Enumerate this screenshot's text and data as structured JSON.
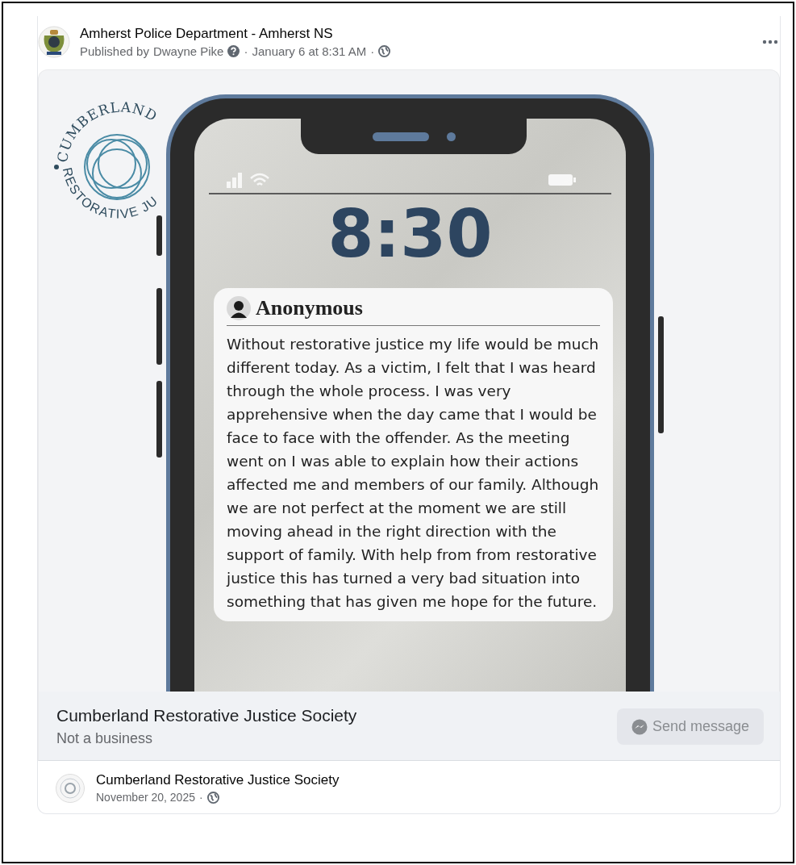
{
  "post": {
    "author": "Amherst Police Department - Amherst NS",
    "published_by_label": "Published by",
    "publisher": "Dwayne Pike",
    "time": "January 6 at 8:31 AM",
    "separator": "·"
  },
  "image": {
    "logo_text_top": "CUMBERLAND",
    "logo_text_bottom": "RESTORATIVE JU",
    "phone": {
      "clock": "8:30",
      "notification": {
        "sender": "Anonymous",
        "message": "Without restorative justice my life would be much different today. As a victim, I felt that I was heard through the whole process. I was very apprehensive when the day came that I would be face to face with the offender. As the meeting went on I was able to explain how their actions affected me and members of our family. Although we are not perfect at the moment we are still moving ahead in the right direction with the support of family. With help from from restorative justice this has turned a very bad situation into something that has given me hope for the future."
      }
    }
  },
  "page_info": {
    "name": "Cumberland Restorative Justice Society",
    "category": "Not a business",
    "button": {
      "label": "Send message",
      "disabled": true
    }
  },
  "shared_post": {
    "author": "Cumberland Restorative Justice Society",
    "date": "November 20, 2025",
    "separator": "·"
  }
}
